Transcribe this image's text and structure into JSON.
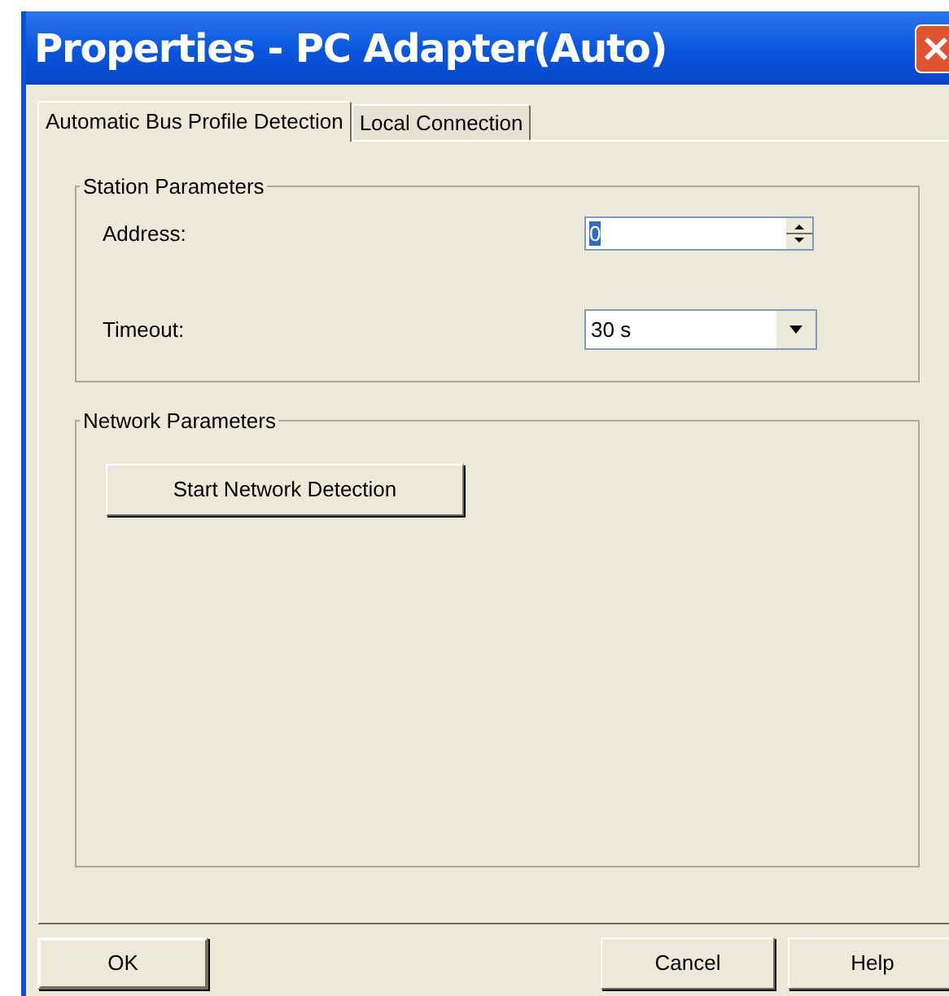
{
  "window": {
    "title": "Properties - PC Adapter(Auto)"
  },
  "tabs": [
    {
      "label": "Automatic Bus Profile Detection",
      "selected": true
    },
    {
      "label": "Local Connection",
      "selected": false
    }
  ],
  "station_parameters": {
    "title": "Station Parameters",
    "address": {
      "label": "Address:",
      "value": "0"
    },
    "timeout": {
      "label": "Timeout:",
      "value": "30 s"
    }
  },
  "network_parameters": {
    "title": "Network Parameters",
    "button": "Start Network Detection"
  },
  "buttons": [
    "OK",
    "Cancel",
    "Help"
  ]
}
